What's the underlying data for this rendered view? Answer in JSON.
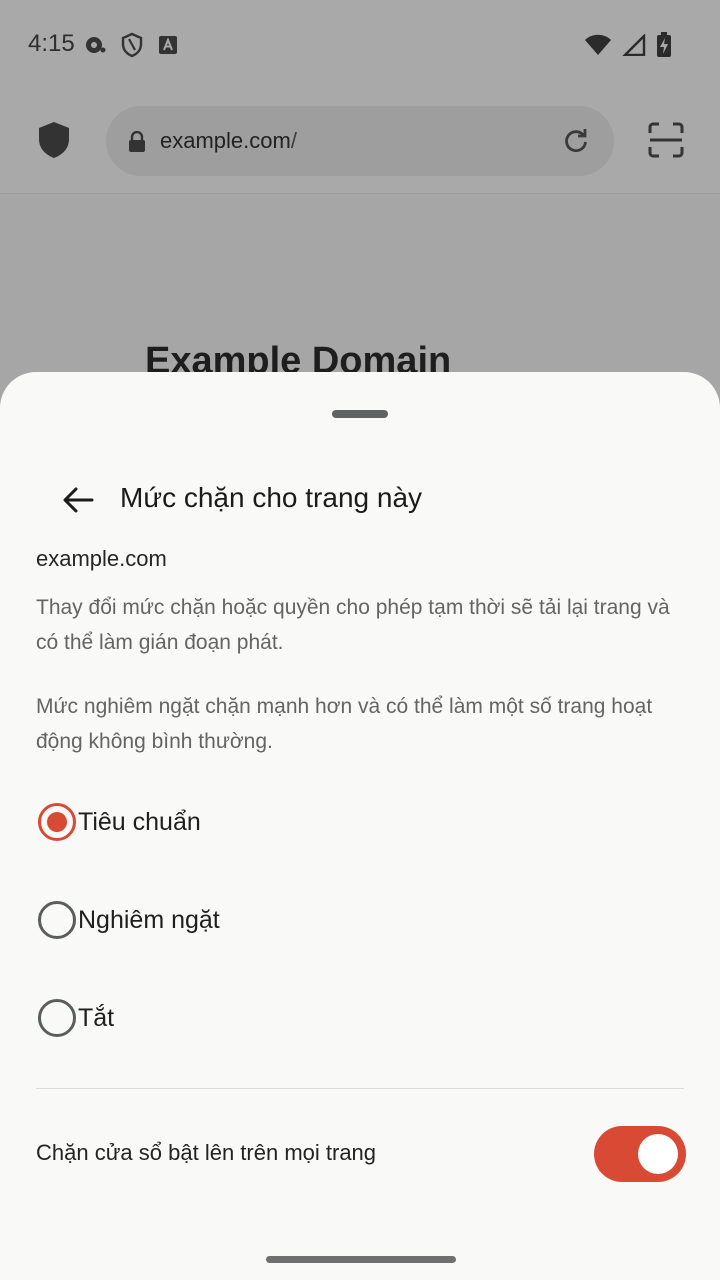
{
  "status_bar": {
    "time": "4:15",
    "left_icons": [
      "media-icon",
      "vpn-shield-icon",
      "keyboard-a-icon"
    ],
    "right_icons": [
      "wifi-icon",
      "cellular-signal-icon",
      "battery-charging-icon"
    ]
  },
  "browser": {
    "url_domain": "example.com",
    "url_path": "/",
    "page_heading": "Example Domain"
  },
  "sheet": {
    "title": "Mức chặn cho trang này",
    "domain": "example.com",
    "description_1": "Thay đổi mức chặn hoặc quyền cho phép tạm thời sẽ tải lại trang và có thể làm gián đoạn phát.",
    "description_2": "Mức nghiêm ngặt chặn mạnh hơn và có thể làm một số trang hoạt động không bình thường.",
    "options": [
      {
        "label": "Tiêu chuẩn",
        "selected": true
      },
      {
        "label": "Nghiêm ngặt",
        "selected": false
      },
      {
        "label": "Tắt",
        "selected": false
      }
    ],
    "popup_toggle": {
      "label": "Chặn cửa sổ bật lên trên mọi trang",
      "on": true
    }
  },
  "colors": {
    "accent": "#d84a34",
    "sheet_bg": "#f9f9f7",
    "scrim": "#a8a8a8"
  }
}
